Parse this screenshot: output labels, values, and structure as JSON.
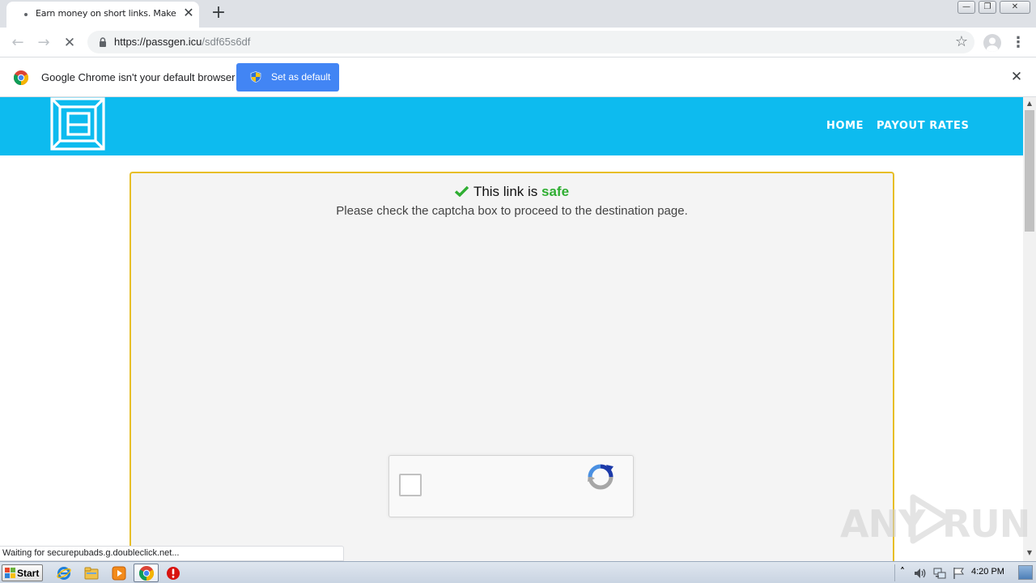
{
  "browser": {
    "tab": {
      "title": "Earn money on short links. Make sho",
      "close_glyph": "✕"
    },
    "new_tab_glyph": "+",
    "window_controls": {
      "minimize": "—",
      "restore": "❐",
      "close": "✕"
    },
    "toolbar": {
      "back_glyph": "←",
      "forward_glyph": "→",
      "stop_glyph": "✕",
      "star_glyph": "☆",
      "menu_glyph": "⋮"
    },
    "address_bar": {
      "host": "https://passgen.icu",
      "path": "/sdf65s6df"
    },
    "status_text": "Waiting for securepubads.g.doubleclick.net..."
  },
  "infobar": {
    "message": "Google Chrome isn't your default browser",
    "button_label": "Set as default",
    "close_glyph": "✕"
  },
  "site": {
    "nav": {
      "home": "HOME",
      "payout_rates": "PAYOUT RATES"
    },
    "notice": {
      "heading_prefix": "This link is ",
      "heading_safe_word": "safe",
      "instruction": "Please check the captcha box to proceed to the destination page."
    },
    "colors": {
      "header": "#0dbbef",
      "box_border": "#e7be27",
      "safe_green": "#2fae32"
    }
  },
  "scrollbar": {
    "up_glyph": "▲",
    "down_glyph": "▼"
  },
  "watermark": {
    "left": "ANY",
    "right": "RUN"
  },
  "taskbar": {
    "start_label": "Start",
    "tray_expand_glyph": "˄",
    "clock": "4:20 PM"
  }
}
